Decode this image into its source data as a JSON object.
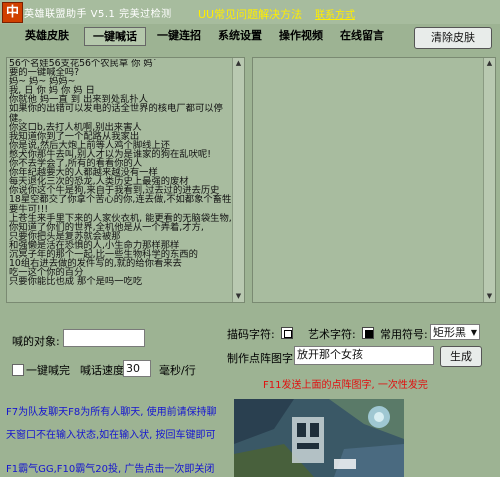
{
  "app": {
    "logo": "中",
    "title": "英雄联盟助手 V5.1 完美过检测",
    "help_link": "UU常见问题解决方法",
    "contact_link": "联系方式"
  },
  "tabs": [
    {
      "label": "英雄皮肤"
    },
    {
      "label": "一键喊话"
    },
    {
      "label": "一键连招"
    },
    {
      "label": "系统设置"
    },
    {
      "label": "操作视频"
    },
    {
      "label": "在线留言"
    }
  ],
  "clear_skin_button": "清除皮肤",
  "chat_text": "56个名娃56支花56个农民草 你 妈`\n要的一键喊全吗?\n妈~ 妈~ 妈妈~\n我, 日 你 妈 你 妈 日\n你就他 妈一直 到 出来到处乱扑人\n如果你的出错可以发电的话全世界的核电厂都可以停\n健。\n你这口b,去打人机啊,别出来害人\n我知道你到了一个配路从我家出\n你是说,然后大炮上前等人鸡个脚线上还\n憋犬你那牛去叫,别人才以为是谁家的狗在乱吠呢!\n你不去学会了,所有的看看你的人\n你年纪越要大的人都越来越没有一样\n每天退化三次的恐龙,人类历史上最强的废材\n你说你这个牛是狗,来自于我看到,过去过的进去历史\n18星空都交了你拿个苦心的你,连去做,不如都象个畜牲\n要牛可!!!\n上苍生来手里下来的人家伙衣机, 能更看的无脑袋生物,\n你知道了你们的世界,全机他是从一个弄着,才方,\n只要你把头是复苏就会被那\n和强懒是活在恐惧的人,小生命力那样那样\n沉冥子年的那个一起,比一些生物科学的东西的\n10组右进去做的发件写的,就的给你看来去\n吃一这个你的百分\n只要你能比也成 那个是吗一吃吃",
  "form": {
    "target_label": "喊的对象:",
    "target_value": "",
    "once_label": "一键喊完",
    "speed_label": "喊话速度:",
    "speed_value": "30",
    "speed_unit": "毫秒/行",
    "stroke_label": "描码字符:",
    "art_label": "艺术字符:",
    "symbol_label": "常用符号:",
    "symbol_value": "矩形黑",
    "dot_label": "制作点阵图字:",
    "dot_value": "放开那个女孩",
    "generate_button": "生成"
  },
  "tips": {
    "red": "F11发送上面的点阵图字, 一次性发完",
    "blue1": "F7为队友聊天F8为所有人聊天, 使用前请保持聊",
    "blue2": "天窗口不在输入状态,如在输入状, 按回车键即可",
    "blue3": "F1霸气GG,F10霸气20投, 广告点击一次即关闭"
  }
}
